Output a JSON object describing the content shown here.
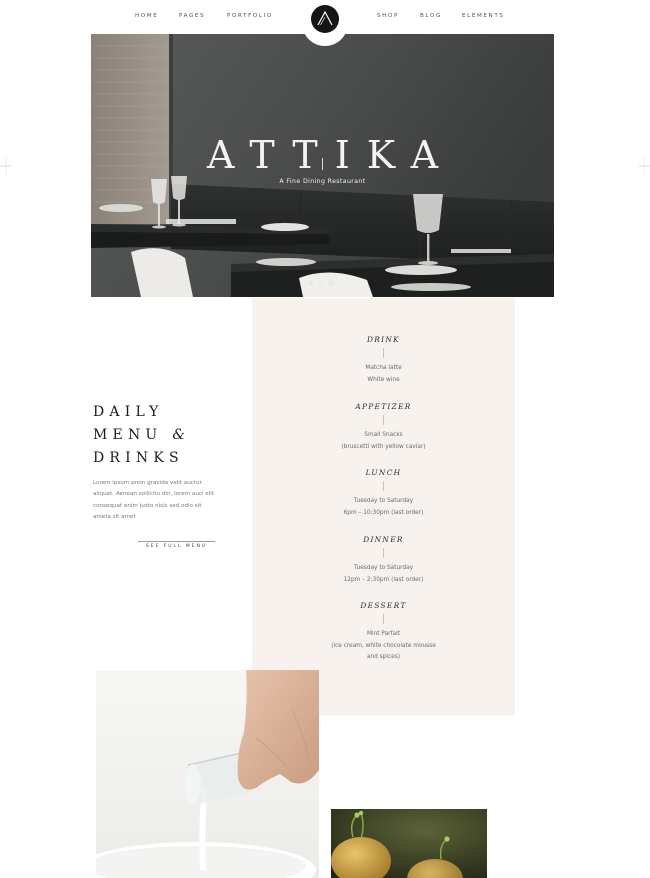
{
  "nav": {
    "left_items": [
      {
        "label": "HOME"
      },
      {
        "label": "PAGES"
      },
      {
        "label": "PORTFOLIO"
      }
    ],
    "right_items": [
      {
        "label": "SHOP"
      },
      {
        "label": "BLOG"
      },
      {
        "label": "ELEMENTS"
      }
    ],
    "logo": {
      "letter": "A",
      "icon": "logo-a-icon",
      "color": "#151515"
    }
  },
  "hero": {
    "title": "ATTIKA",
    "subtitle": "A Fine Dining Restaurant",
    "slides": 3,
    "active_slide": 1
  },
  "menu": {
    "sections": [
      {
        "heading": "DRINK",
        "lines": [
          "Matcha latte",
          "White wine"
        ]
      },
      {
        "heading": "APPETIZER",
        "lines": [
          "Small Snacks",
          "(bruscetti with yellow caviar)"
        ]
      },
      {
        "heading": "LUNCH",
        "lines": [
          "Tuesday to Saturday",
          "6pm – 10:30pm (last order)"
        ]
      },
      {
        "heading": "DINNER",
        "lines": [
          "Tuesday to Saturday",
          "12pm – 2:30pm (last order)"
        ]
      },
      {
        "heading": "DESSERT",
        "lines": [
          "Mint Parfait",
          "(ice cream, white chocolate mousse",
          "and spices)"
        ]
      }
    ],
    "panel_color": "#f7f2ee"
  },
  "daily": {
    "title_lines": [
      "DAILY",
      "MENU",
      "DRINKS"
    ],
    "ampersand": "&",
    "description": "Lorem ipsum proin gravida velit auctor aliquet. Aenean sollicitu din, lorem auci elit consequat enim justo nisis sed odio sit ameta sit amet",
    "link_label": "SEE FULL MENU"
  },
  "colors": {
    "accent_dark": "#151515",
    "text_muted": "#7a7a7a"
  }
}
